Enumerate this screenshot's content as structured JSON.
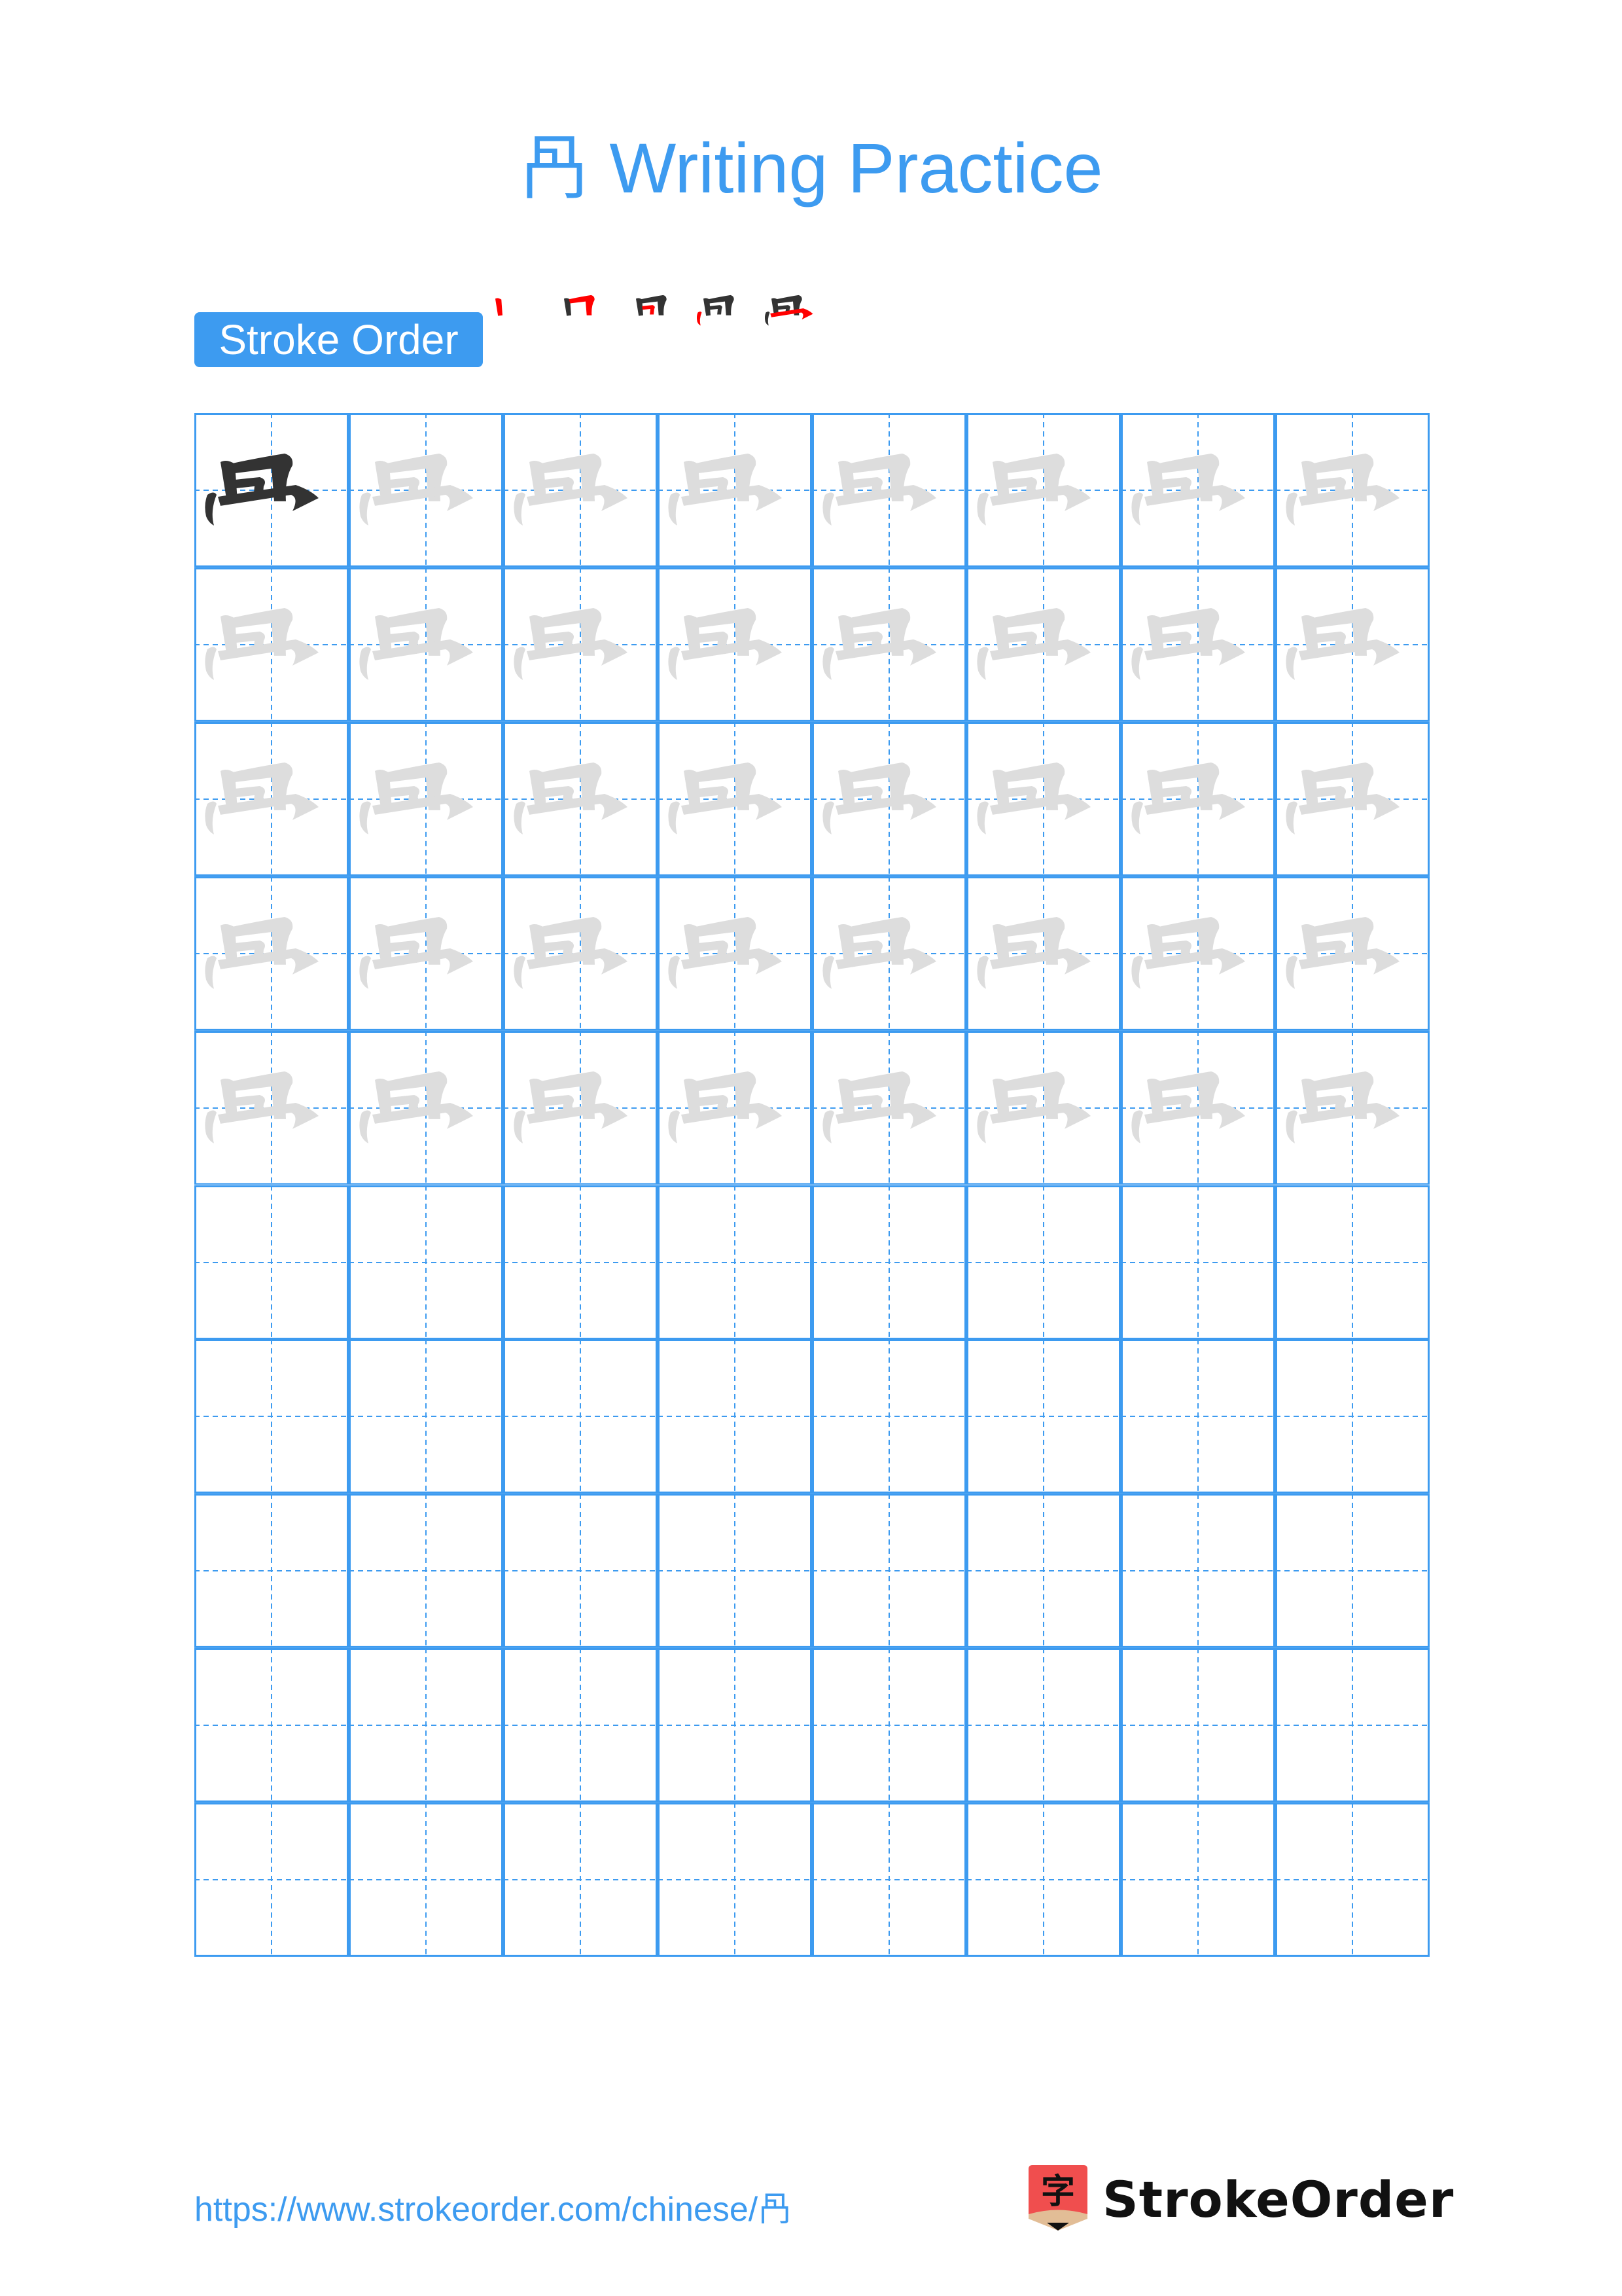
{
  "page": {
    "character": "冎",
    "title_suffix": "Writing Practice",
    "title": "冎 Writing Practice"
  },
  "stroke_order": {
    "label": "Stroke Order",
    "step_count": 5,
    "highlight_color": "#ff0000",
    "ink_color": "#333333"
  },
  "grid": {
    "columns": 8,
    "rows": 10,
    "model_cells": 1,
    "trace_rows": 5,
    "blank_rows": 5,
    "line_color": "#3d9bf0",
    "trace_color": "#dddddd"
  },
  "footer": {
    "url": "https://www.strokeorder.com/chinese/冎",
    "brand": "StrokeOrder",
    "logo_glyph": "字",
    "logo_color": "#f04e4e"
  }
}
